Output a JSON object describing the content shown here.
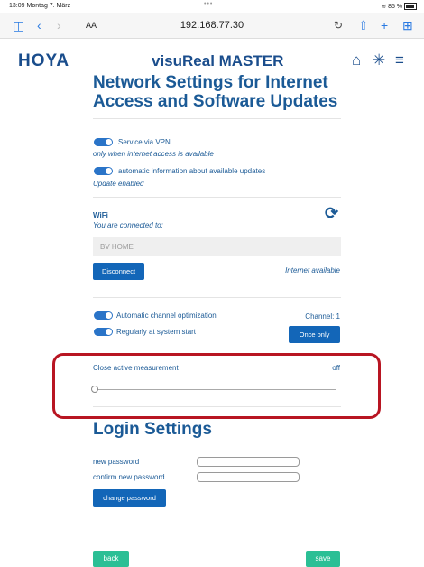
{
  "status_bar": {
    "time": "13:09",
    "date": "Montag 7. März",
    "battery": "85 %"
  },
  "browser": {
    "text_size": "AA",
    "url": "192.168.77.30"
  },
  "header": {
    "brand": "HOYA",
    "title": "visuReal MASTER"
  },
  "network": {
    "heading_line1": "Network Settings for Internet",
    "heading_line2": "Access and Software Updates",
    "vpn": {
      "label": "Service via VPN",
      "on": true,
      "note": "only when internet access is available"
    },
    "updates": {
      "label": "automatic information about available updates",
      "on": true,
      "note": "Update enabled"
    }
  },
  "wifi": {
    "title": "WiFi",
    "connected_text": "You are connected to:",
    "ssid": "BV HOME",
    "disconnect_label": "Disconnect",
    "internet_status": "Internet available"
  },
  "channel": {
    "auto_label": "Automatic channel optimization",
    "auto_on": true,
    "channel_text": "Channel: 1",
    "startup_label": "Regularly at system start",
    "startup_on": true,
    "once_label": "Once only"
  },
  "close_measurement": {
    "label": "Close active measurement",
    "value": "off",
    "slider_fraction": 0
  },
  "login": {
    "heading": "Login Settings",
    "new_password_label": "new password",
    "confirm_password_label": "confirm new password",
    "new_password_value": "",
    "confirm_password_value": "",
    "change_label": "change password"
  },
  "footer": {
    "back_label": "back",
    "save_label": "save"
  },
  "colors": {
    "accent": "#1366b8",
    "text": "#1b5a96",
    "highlight": "#b81522",
    "green": "#2bbf95"
  }
}
